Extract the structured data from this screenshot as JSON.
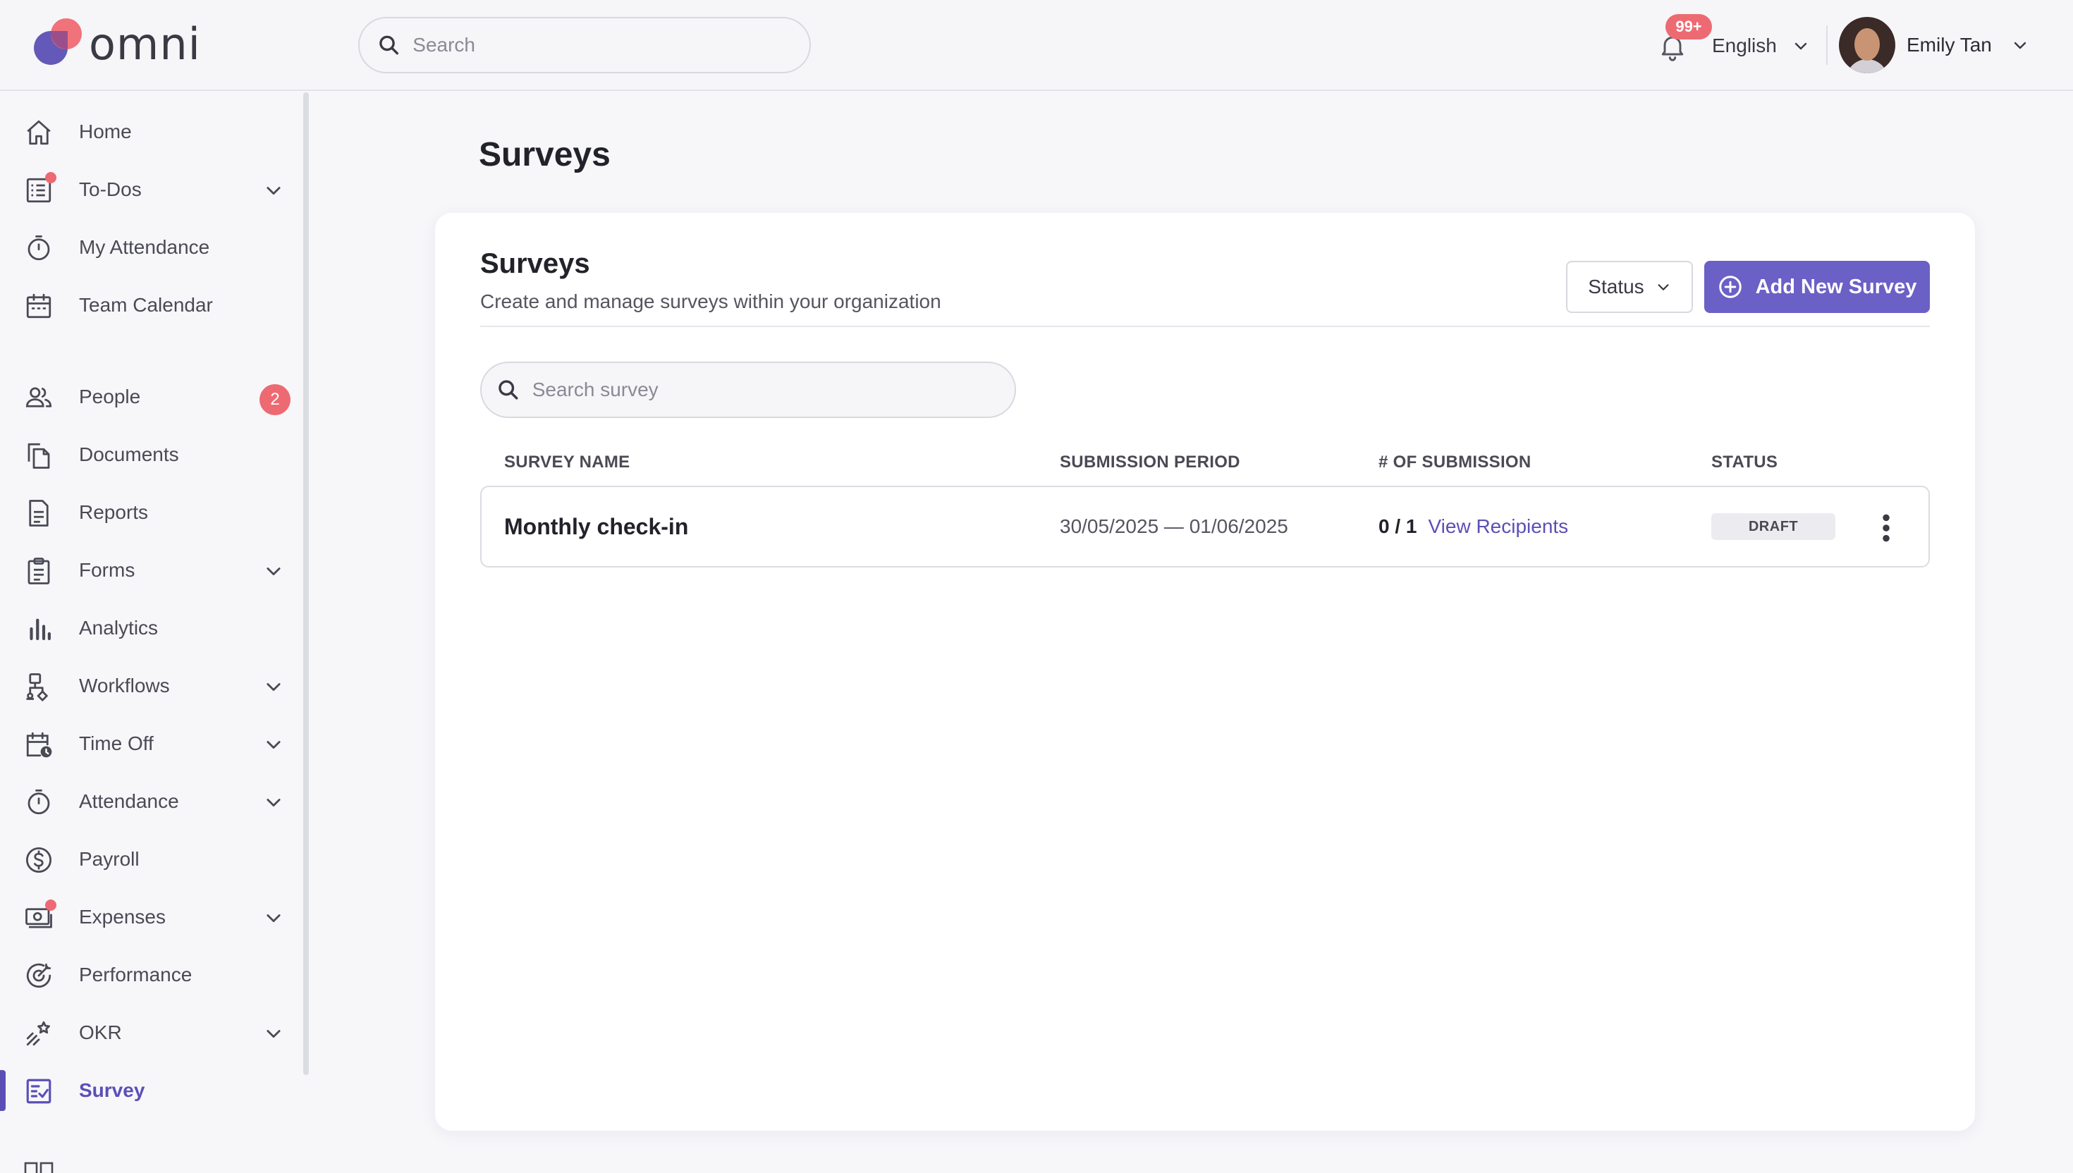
{
  "app": {
    "logo_text": "omni"
  },
  "header": {
    "search_placeholder": "Search",
    "notifications_badge": "99+",
    "language": "English",
    "user_name": "Emily Tan"
  },
  "sidebar": {
    "items": [
      {
        "label": "Home",
        "icon": "home-icon"
      },
      {
        "label": "To-Dos",
        "icon": "todo-list-icon",
        "expandable": true,
        "dot": true
      },
      {
        "label": "My Attendance",
        "icon": "stopwatch-icon"
      },
      {
        "label": "Team Calendar",
        "icon": "calendar-icon"
      },
      {
        "label": "People",
        "icon": "people-icon",
        "badge": "2"
      },
      {
        "label": "Documents",
        "icon": "documents-icon"
      },
      {
        "label": "Reports",
        "icon": "report-icon"
      },
      {
        "label": "Forms",
        "icon": "clipboard-icon",
        "expandable": true
      },
      {
        "label": "Analytics",
        "icon": "bar-chart-icon"
      },
      {
        "label": "Workflows",
        "icon": "workflow-icon",
        "expandable": true
      },
      {
        "label": "Time Off",
        "icon": "calendar-clock-icon",
        "expandable": true
      },
      {
        "label": "Attendance",
        "icon": "stopwatch-icon",
        "expandable": true
      },
      {
        "label": "Payroll",
        "icon": "dollar-icon"
      },
      {
        "label": "Expenses",
        "icon": "expenses-icon",
        "expandable": true,
        "dot": true
      },
      {
        "label": "Performance",
        "icon": "performance-icon"
      },
      {
        "label": "OKR",
        "icon": "okr-icon",
        "expandable": true
      },
      {
        "label": "Survey",
        "icon": "survey-icon",
        "active": true
      }
    ]
  },
  "main": {
    "page_title": "Surveys",
    "card": {
      "title": "Surveys",
      "subtitle": "Create and manage surveys within your organization",
      "status_filter_label": "Status",
      "add_button_label": "Add New Survey",
      "search_placeholder": "Search survey",
      "columns": [
        "SURVEY NAME",
        "SUBMISSION PERIOD",
        "# OF SUBMISSION",
        "STATUS"
      ],
      "rows": [
        {
          "name": "Monthly check-in",
          "period": "30/05/2025 — 01/06/2025",
          "submissions": "0 / 1",
          "view_link": "View Recipients",
          "status": "DRAFT"
        }
      ]
    }
  },
  "colors": {
    "accent": "#6b60c6",
    "accent_text": "#5b4fb6",
    "badge": "#ee6a72",
    "background": "#f7f7fa"
  }
}
